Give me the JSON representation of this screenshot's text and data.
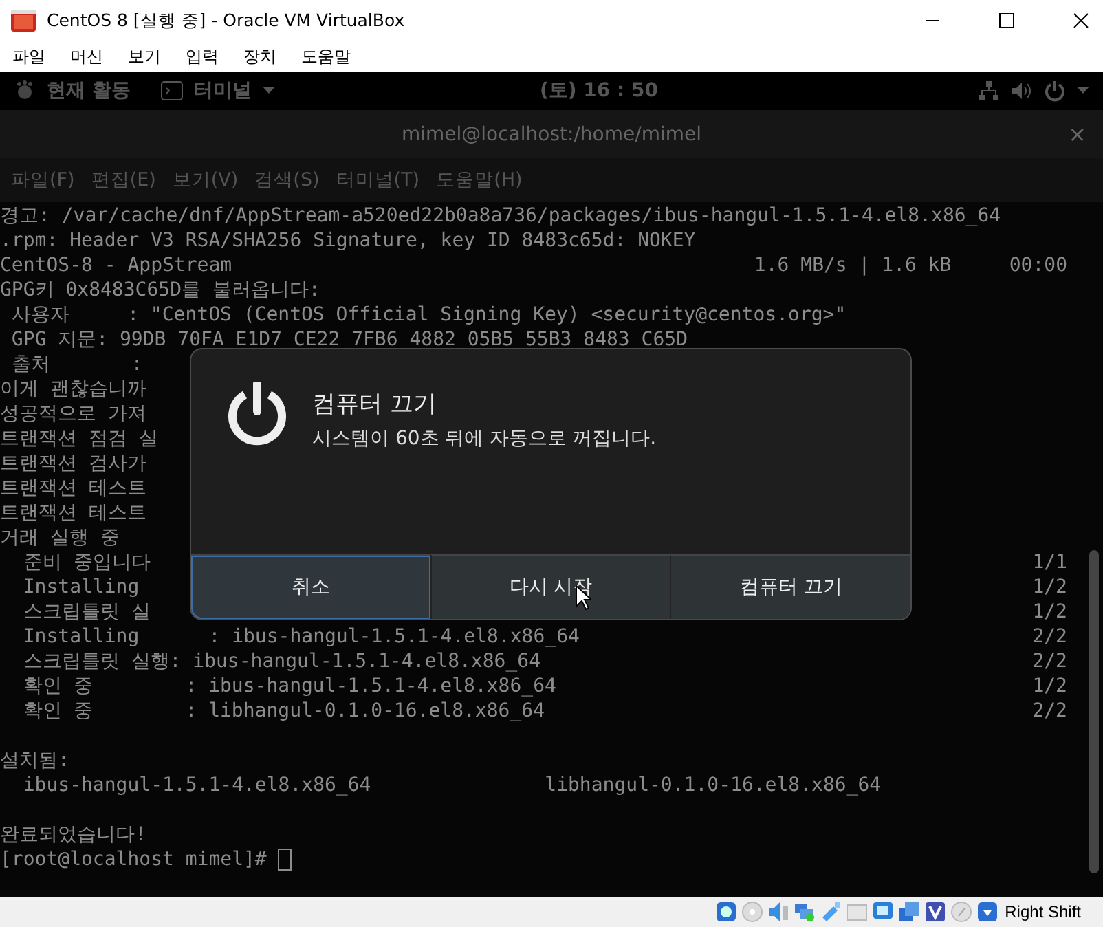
{
  "vbox": {
    "title": "CentOS 8 [실행 중] - Oracle VM VirtualBox",
    "menu": [
      "파일",
      "머신",
      "보기",
      "입력",
      "장치",
      "도움말"
    ],
    "host_key": "Right Shift"
  },
  "gnome_bar": {
    "activities": "현재 활동",
    "app": "터미널",
    "clock": "(토) 16 : 50"
  },
  "terminal": {
    "title": "mimel@localhost:/home/mimel",
    "close": "×",
    "menu": [
      "파일(F)",
      "편집(E)",
      "보기(V)",
      "검색(S)",
      "터미널(T)",
      "도움말(H)"
    ],
    "lines": [
      {
        "text": "경고: /var/cache/dnf/AppStream-a520ed22b0a8a736/packages/ibus-hangul-1.5.1-4.el8.x86_64"
      },
      {
        "text": ".rpm: Header V3 RSA/SHA256 Signature, key ID 8483c65d: NOKEY"
      },
      {
        "text": "CentOS-8 - AppStream",
        "right": "1.6 MB/s | 1.6 kB     00:00"
      },
      {
        "text": "GPG키 0x8483C65D를 불러옵니다:"
      },
      {
        "text": " 사용자     : \"CentOS (CentOS Official Signing Key) <security@centos.org>\""
      },
      {
        "text": " GPG 지문: 99DB 70FA E1D7 CE22 7FB6 4882 05B5 55B3 8483 C65D"
      },
      {
        "text": " 출처       :"
      },
      {
        "text": "이게 괜찮습니까"
      },
      {
        "text": "성공적으로 가져"
      },
      {
        "text": "트랜잭션 점검 실"
      },
      {
        "text": "트랜잭션 검사가"
      },
      {
        "text": "트랜잭션 테스트"
      },
      {
        "text": "트랜잭션 테스트"
      },
      {
        "text": "거래 실행 중"
      },
      {
        "text": "  준비 중입니다",
        "right": "1/1"
      },
      {
        "text": "  Installing",
        "right": "1/2"
      },
      {
        "text": "  스크립틀릿 실",
        "right": "1/2"
      },
      {
        "text": "  Installing      : ibus-hangul-1.5.1-4.el8.x86_64",
        "right": "2/2"
      },
      {
        "text": "  스크립틀릿 실행: ibus-hangul-1.5.1-4.el8.x86_64",
        "right": "2/2"
      },
      {
        "text": "  확인 중        : ibus-hangul-1.5.1-4.el8.x86_64",
        "right": "1/2"
      },
      {
        "text": "  확인 중        : libhangul-0.1.0-16.el8.x86_64",
        "right": "2/2"
      },
      {
        "text": "설치됨:",
        "gap_before": true
      },
      {
        "text": "  ibus-hangul-1.5.1-4.el8.x86_64               libhangul-0.1.0-16.el8.x86_64"
      },
      {
        "text": "완료되었습니다!",
        "gap_before": true
      },
      {
        "text": "[root@localhost mimel]# ",
        "cursor": true
      }
    ]
  },
  "dialog": {
    "title": "컴퓨터 끄기",
    "message": "시스템이 60초 뒤에 자동으로 꺼집니다.",
    "buttons": [
      {
        "label": "취소",
        "focused": true
      },
      {
        "label": "다시 시작",
        "focused": false
      },
      {
        "label": "컴퓨터 끄기",
        "focused": false
      }
    ]
  }
}
